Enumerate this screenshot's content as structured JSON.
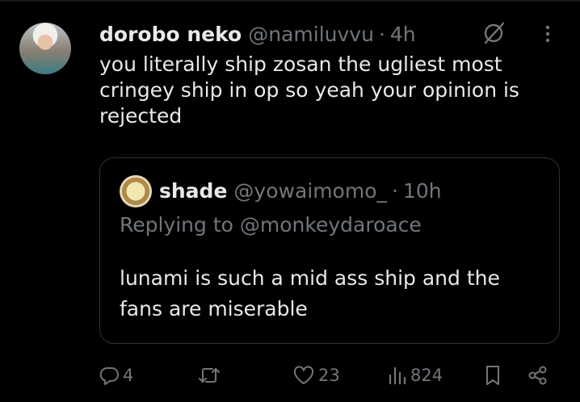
{
  "tweet": {
    "name": "dorobo neko",
    "handle": "@namiluvvu",
    "separator": "·",
    "time": "4h",
    "text": "you literally ship zosan the ugliest most cringey ship in op so yeah your opinion is rejected"
  },
  "quote": {
    "name": "shade",
    "handle": "@yowaimomo_",
    "separator": "·",
    "time": "10h",
    "replying_to": "Replying to @monkeydaroace",
    "text": "lunami is such a mid ass ship and the fans are miserable"
  },
  "actions": {
    "replies": "4",
    "retweets": "",
    "likes": "23",
    "views": "824"
  },
  "icons": {
    "grok": "grok-icon",
    "more": "more-icon",
    "reply": "reply-icon",
    "retweet": "retweet-icon",
    "like": "heart-icon",
    "views": "views-icon",
    "bookmark": "bookmark-icon",
    "share": "share-icon"
  },
  "colors": {
    "background": "#000000",
    "text": "#e7e9ea",
    "secondary": "#71767b",
    "border": "#2f3336"
  }
}
